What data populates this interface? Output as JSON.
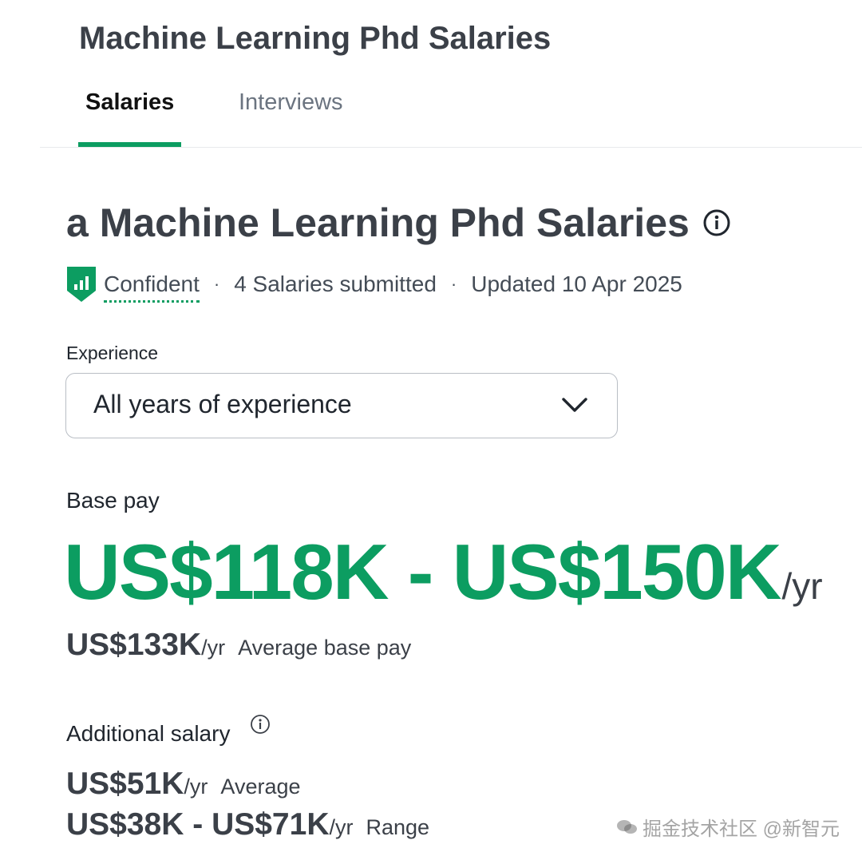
{
  "header": {
    "title": "Machine Learning Phd Salaries"
  },
  "tabs": [
    {
      "label": "Salaries",
      "active": true
    },
    {
      "label": "Interviews",
      "active": false
    }
  ],
  "summary": {
    "heading": "a Machine Learning Phd Salaries",
    "confidence": "Confident",
    "salaries_submitted": "4 Salaries submitted",
    "updated": "Updated 10 Apr 2025",
    "separator": "·"
  },
  "experience_filter": {
    "label": "Experience",
    "selected": "All years of experience"
  },
  "base_pay": {
    "label": "Base pay",
    "range": "US$118K - US$150K",
    "unit": "/yr",
    "average_amount": "US$133K",
    "average_unit": "/yr",
    "average_label": "Average base pay"
  },
  "additional_salary": {
    "label": "Additional salary",
    "average_amount": "US$51K",
    "average_unit": "/yr",
    "average_label": "Average",
    "range_amount": "US$38K - US$71K",
    "range_unit": "/yr",
    "range_label": "Range"
  },
  "watermark": {
    "text": "掘金技术社区 @新智元"
  },
  "colors": {
    "accent": "#0c9d61",
    "heading": "#3b4048",
    "muted": "#6b7480"
  },
  "icons": {
    "heading_info": "info-icon",
    "confidence": "shield-chart-icon",
    "dropdown": "chevron-down-icon",
    "additional_info": "info-icon",
    "watermark": "chat-bubble-icon"
  }
}
